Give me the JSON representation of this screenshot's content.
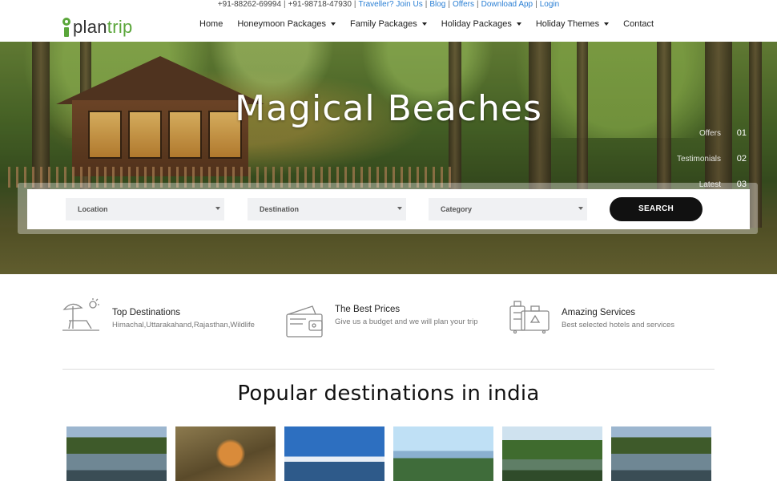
{
  "topbar": {
    "phone1": "+91-88262-69994",
    "phone2": "+91-98718-47930",
    "links": [
      "Traveller? Join Us",
      "Blog",
      "Offers",
      "Download App",
      "Login"
    ]
  },
  "logo": {
    "text_a": "plan",
    "text_b": "trip"
  },
  "nav": {
    "items": [
      {
        "label": "Home",
        "dropdown": false
      },
      {
        "label": "Honeymoon Packages",
        "dropdown": true
      },
      {
        "label": "Family Packages",
        "dropdown": true
      },
      {
        "label": "Holiday Packages",
        "dropdown": true
      },
      {
        "label": "Holiday Themes",
        "dropdown": true
      },
      {
        "label": "Contact",
        "dropdown": false
      }
    ]
  },
  "hero": {
    "title": "Magical Beaches",
    "slider": [
      {
        "label": "Offers",
        "num": "01"
      },
      {
        "label": "Testimonials",
        "num": "02"
      },
      {
        "label": "Latest",
        "num": "03"
      }
    ]
  },
  "search": {
    "location": "Location",
    "destination": "Destination",
    "category": "Category",
    "button": "SEARCH"
  },
  "features": [
    {
      "title": "Top Destinations",
      "desc": "Himachal,Uttarakahand,Rajasthan,Wildlife",
      "icon": "beach-chair-icon"
    },
    {
      "title": "The Best Prices",
      "desc": "Give us a budget and we will plan your trip",
      "icon": "wallet-icon"
    },
    {
      "title": "Amazing Services",
      "desc": "Best selected hotels and services",
      "icon": "luggage-icon"
    }
  ],
  "popular": {
    "title": "Popular destinations in india",
    "thumbs": [
      "lake",
      "tiger",
      "snow-mountains",
      "valley",
      "river-valley",
      "lake"
    ]
  },
  "colors": {
    "brand_green": "#5aa63a",
    "link_blue": "#2a7fd4",
    "button_dark": "#111111"
  }
}
